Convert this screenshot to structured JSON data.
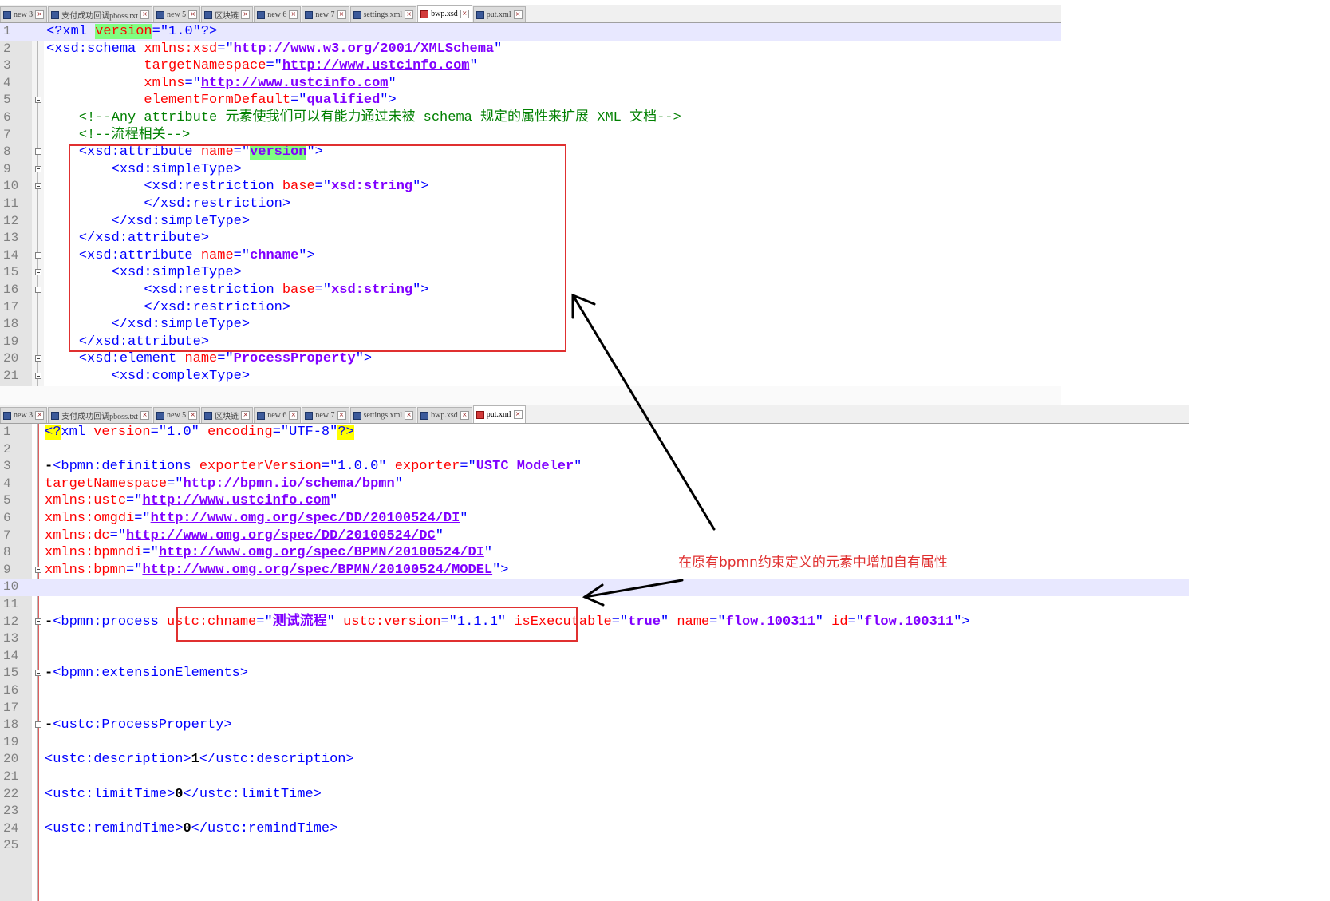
{
  "top_tabs": [
    {
      "label": "new 3",
      "active": false
    },
    {
      "label": "支付成功回调pboss.txt",
      "active": false
    },
    {
      "label": "new 5",
      "active": false
    },
    {
      "label": "区块链",
      "active": false
    },
    {
      "label": "new 6",
      "active": false
    },
    {
      "label": "new 7",
      "active": false
    },
    {
      "label": "settings.xml",
      "active": false
    },
    {
      "label": "bwp.xsd",
      "active": true
    },
    {
      "label": "put.xml",
      "active": false
    }
  ],
  "bottom_tabs": [
    {
      "label": "new 3",
      "active": false
    },
    {
      "label": "支付成功回调pboss.txt",
      "active": false
    },
    {
      "label": "new 5",
      "active": false
    },
    {
      "label": "区块链",
      "active": false
    },
    {
      "label": "new 6",
      "active": false
    },
    {
      "label": "new 7",
      "active": false
    },
    {
      "label": "settings.xml",
      "active": false
    },
    {
      "label": "bwp.xsd",
      "active": false
    },
    {
      "label": "put.xml",
      "active": true
    }
  ],
  "top_editor": {
    "file": "bwp.xsd",
    "lines": [
      {
        "n": "1",
        "fold": false,
        "cur": true,
        "html": "<span class='t'>&lt;?xml </span><span class='a hl'>version</span><span class='t'>=\"1.0\"?&gt;</span>"
      },
      {
        "n": "2",
        "fold": false,
        "html": "<span class='t'>&lt;xsd:schema </span><span class='a'>xmlns:xsd</span><span class='t'>=\"</span><span class='u'>http://www.w3.org/2001/XMLSchema</span><span class='t'>\"</span>"
      },
      {
        "n": "3",
        "fold": false,
        "html": "            <span class='a'>targetNamespace</span><span class='t'>=\"</span><span class='u'>http://www.ustcinfo.com</span><span class='t'>\"</span>"
      },
      {
        "n": "4",
        "fold": false,
        "html": "            <span class='a'>xmlns</span><span class='t'>=\"</span><span class='u'>http://www.ustcinfo.com</span><span class='t'>\"</span>"
      },
      {
        "n": "5",
        "fold": true,
        "html": "            <span class='a'>elementFormDefault</span><span class='t'>=\"</span><span class='v'>qualified</span><span class='t'>\"&gt;</span>"
      },
      {
        "n": "6",
        "fold": false,
        "html": "    <span class='c'>&lt;!--Any attribute 元素使我们可以有能力通过未被 schema 规定的属性来扩展 XML 文档--&gt;</span>"
      },
      {
        "n": "7",
        "fold": false,
        "html": "    <span class='c'>&lt;!--流程相关--&gt;</span>"
      },
      {
        "n": "8",
        "fold": true,
        "html": "    <span class='t'>&lt;xsd:attribute </span><span class='a'>name</span><span class='t'>=\"</span><span class='v hl'>version</span><span class='t'>\"&gt;</span>"
      },
      {
        "n": "9",
        "fold": true,
        "html": "        <span class='t'>&lt;xsd:simpleType&gt;</span>"
      },
      {
        "n": "10",
        "fold": true,
        "html": "            <span class='t'>&lt;xsd:restriction </span><span class='a'>base</span><span class='t'>=\"</span><span class='v'>xsd:string</span><span class='t'>\"&gt;</span>"
      },
      {
        "n": "11",
        "fold": false,
        "html": "            <span class='t'>&lt;/xsd:restriction&gt;</span>"
      },
      {
        "n": "12",
        "fold": false,
        "html": "        <span class='t'>&lt;/xsd:simpleType&gt;</span>"
      },
      {
        "n": "13",
        "fold": false,
        "html": "    <span class='t'>&lt;/xsd:attribute&gt;</span>"
      },
      {
        "n": "14",
        "fold": true,
        "html": "    <span class='t'>&lt;xsd:attribute </span><span class='a'>name</span><span class='t'>=\"</span><span class='v'>chname</span><span class='t'>\"&gt;</span>"
      },
      {
        "n": "15",
        "fold": true,
        "html": "        <span class='t'>&lt;xsd:simpleType&gt;</span>"
      },
      {
        "n": "16",
        "fold": true,
        "html": "            <span class='t'>&lt;xsd:restriction </span><span class='a'>base</span><span class='t'>=\"</span><span class='v'>xsd:string</span><span class='t'>\"&gt;</span>"
      },
      {
        "n": "17",
        "fold": false,
        "html": "            <span class='t'>&lt;/xsd:restriction&gt;</span>"
      },
      {
        "n": "18",
        "fold": false,
        "html": "        <span class='t'>&lt;/xsd:simpleType&gt;</span>"
      },
      {
        "n": "19",
        "fold": false,
        "html": "    <span class='t'>&lt;/xsd:attribute&gt;</span>"
      },
      {
        "n": "20",
        "fold": true,
        "html": "    <span class='t'>&lt;xsd:element </span><span class='a'>name</span><span class='t'>=\"</span><span class='v'>ProcessProperty</span><span class='t'>\"&gt;</span>"
      },
      {
        "n": "21",
        "fold": true,
        "html": "        <span class='t'>&lt;xsd:complexType&gt;</span>"
      }
    ]
  },
  "bottom_editor": {
    "file": "put.xml",
    "lines": [
      {
        "n": "1",
        "fold": false,
        "html": "<span class='t hly'>&lt;?</span><span class='t'>xml </span><span class='a'>version</span><span class='t'>=\"1.0\" </span><span class='a'>encoding</span><span class='t'>=\"UTF-8\"</span><span class='t hly'>?&gt;</span>"
      },
      {
        "n": "2",
        "fold": false,
        "html": ""
      },
      {
        "n": "3",
        "fold": false,
        "html": "<span class='k'>-</span><span class='t'>&lt;bpmn:definitions </span><span class='a'>exporterVersion</span><span class='t'>=\"1.0.0\" </span><span class='a'>exporter</span><span class='t'>=\"</span><span class='v'>USTC Modeler</span><span class='t'>\"</span>"
      },
      {
        "n": "4",
        "fold": false,
        "html": "<span class='a'>targetNamespace</span><span class='t'>=\"</span><span class='u'>http://bpmn.io/schema/bpmn</span><span class='t'>\"</span>"
      },
      {
        "n": "5",
        "fold": false,
        "html": "<span class='a'>xmlns:ustc</span><span class='t'>=\"</span><span class='u'>http://www.ustcinfo.com</span><span class='t'>\"</span>"
      },
      {
        "n": "6",
        "fold": false,
        "html": "<span class='a'>xmlns:omgdi</span><span class='t'>=\"</span><span class='u'>http://www.omg.org/spec/DD/20100524/DI</span><span class='t'>\"</span>"
      },
      {
        "n": "7",
        "fold": false,
        "html": "<span class='a'>xmlns:dc</span><span class='t'>=\"</span><span class='u'>http://www.omg.org/spec/DD/20100524/DC</span><span class='t'>\"</span>"
      },
      {
        "n": "8",
        "fold": false,
        "html": "<span class='a'>xmlns:bpmndi</span><span class='t'>=\"</span><span class='u'>http://www.omg.org/spec/BPMN/20100524/DI</span><span class='t'>\"</span>"
      },
      {
        "n": "9",
        "fold": true,
        "html": "<span class='a'>xmlns:bpmn</span><span class='t'>=\"</span><span class='u'>http://www.omg.org/spec/BPMN/20100524/MODEL</span><span class='t'>\"&gt;</span>"
      },
      {
        "n": "10",
        "fold": false,
        "cur": true,
        "html": "<span class='cursor'></span>"
      },
      {
        "n": "11",
        "fold": false,
        "html": ""
      },
      {
        "n": "12",
        "fold": true,
        "html": "<span class='k'>-</span><span class='t'>&lt;bpmn:process </span><span class='a'>ustc:chname</span><span class='t'>=\"</span><span class='v'>测试流程</span><span class='t'>\" </span><span class='a'>ustc:version</span><span class='t'>=\"1.1.1\" </span><span class='a'>isExecutable</span><span class='t'>=\"</span><span class='v'>true</span><span class='t'>\" </span><span class='a'>name</span><span class='t'>=\"</span><span class='v'>flow.100311</span><span class='t'>\" </span><span class='a'>id</span><span class='t'>=\"</span><span class='v'>flow.100311</span><span class='t'>\"&gt;</span>"
      },
      {
        "n": "13",
        "fold": false,
        "html": ""
      },
      {
        "n": "14",
        "fold": false,
        "html": ""
      },
      {
        "n": "15",
        "fold": true,
        "html": "<span class='k'>-</span><span class='t'>&lt;bpmn:extensionElements&gt;</span>"
      },
      {
        "n": "16",
        "fold": false,
        "html": ""
      },
      {
        "n": "17",
        "fold": false,
        "html": ""
      },
      {
        "n": "18",
        "fold": true,
        "html": "<span class='k'>-</span><span class='t'>&lt;ustc:ProcessProperty&gt;</span>"
      },
      {
        "n": "19",
        "fold": false,
        "html": ""
      },
      {
        "n": "20",
        "fold": false,
        "html": "<span class='t'>&lt;ustc:description&gt;</span><span class='k'>1</span><span class='t'>&lt;/ustc:description&gt;</span>"
      },
      {
        "n": "21",
        "fold": false,
        "html": ""
      },
      {
        "n": "22",
        "fold": false,
        "html": "<span class='t'>&lt;ustc:limitTime&gt;</span><span class='k'>0</span><span class='t'>&lt;/ustc:limitTime&gt;</span>"
      },
      {
        "n": "23",
        "fold": false,
        "html": ""
      },
      {
        "n": "24",
        "fold": false,
        "html": "<span class='t'>&lt;ustc:remindTime&gt;</span><span class='k'>0</span><span class='t'>&lt;/ustc:remindTime&gt;</span>"
      },
      {
        "n": "25",
        "fold": false,
        "html": ""
      }
    ]
  },
  "annotation": {
    "note": "在原有bpmn约束定义的元素中增加自有属性",
    "color": "#e03030"
  }
}
